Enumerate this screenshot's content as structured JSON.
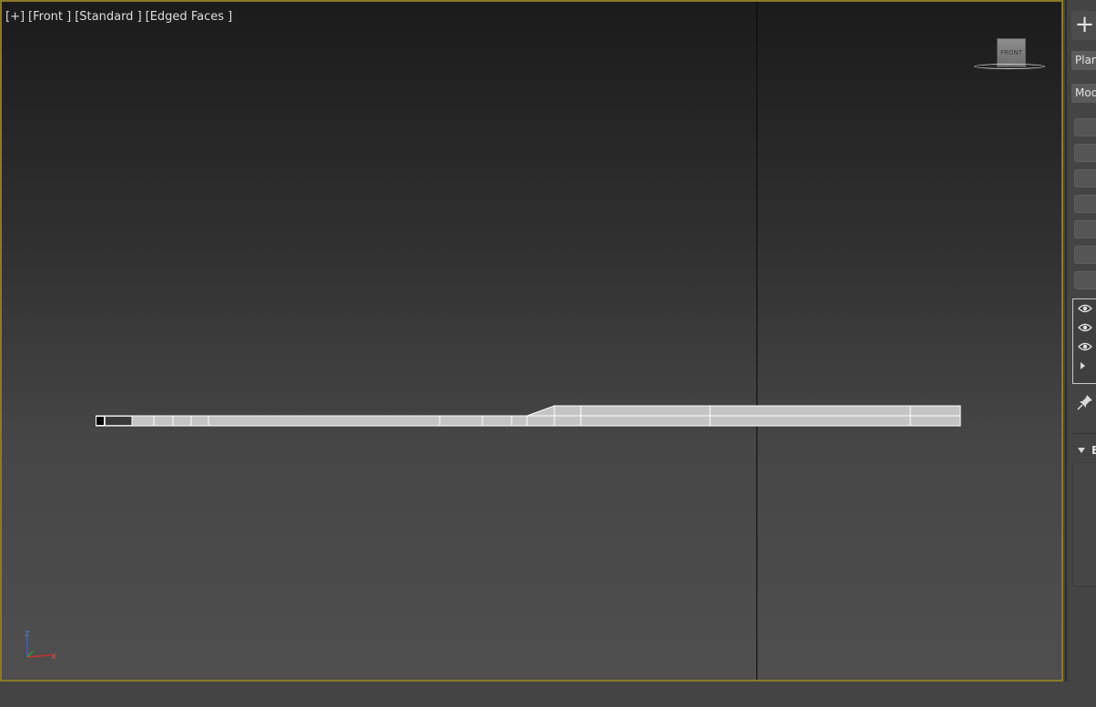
{
  "viewport": {
    "labels": [
      "[+]",
      "[Front ]",
      "[Standard ]",
      "[Edged Faces ]"
    ],
    "viewcube_face": "FRONT",
    "axis": {
      "z": "z",
      "x": "x"
    }
  },
  "command_panel": {
    "create_icon": "+",
    "category_dropdown": "Plane",
    "modifier_list": "Modifier List",
    "stack_icons": [
      "eye-icon",
      "eye-icon",
      "eye-icon",
      "expand-triangle-icon"
    ],
    "rollout_letter": "B"
  }
}
